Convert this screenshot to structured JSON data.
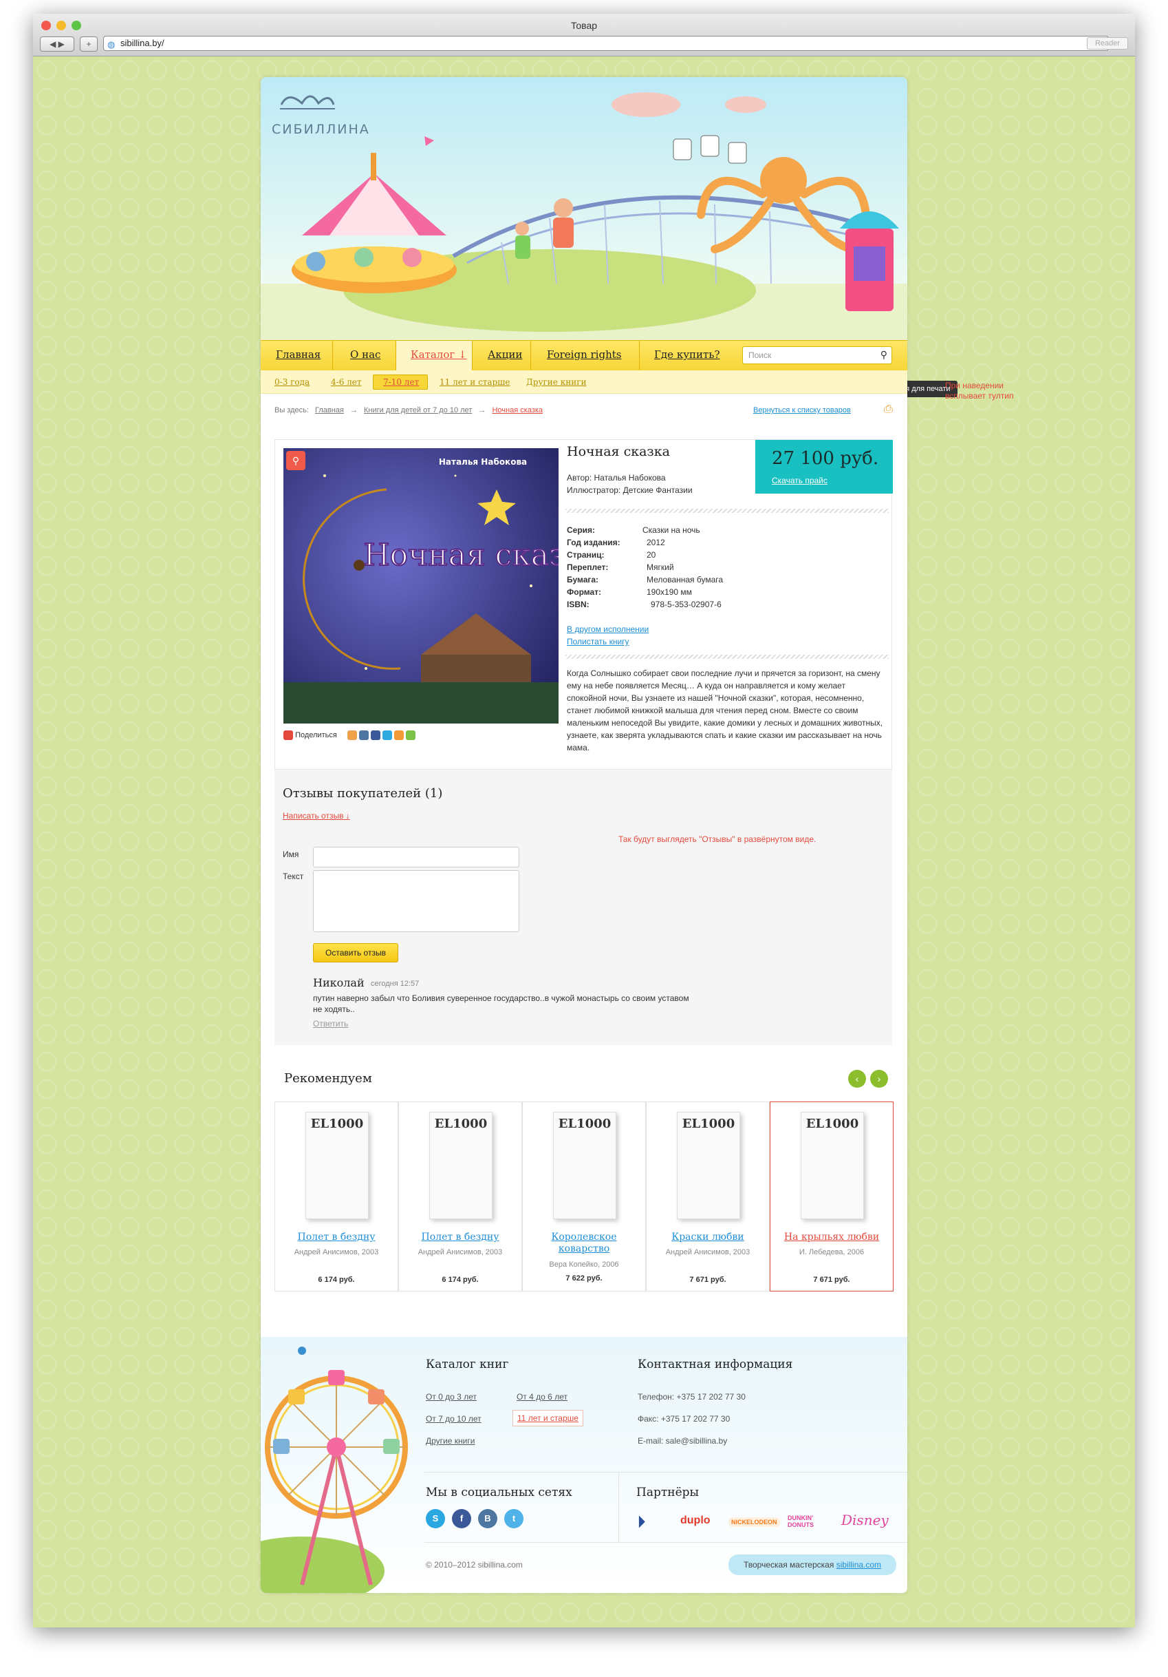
{
  "window": {
    "title": "Товар",
    "url": "sibillina.by/",
    "reader": "Reader"
  },
  "header": {
    "logo": "СИБИЛЛИНА"
  },
  "nav": {
    "items": [
      "Главная",
      "О нас",
      "Каталог ↓",
      "Акции",
      "Foreign rights",
      "Где купить?"
    ],
    "search_placeholder": "Поиск"
  },
  "subnav": [
    "0-3 года",
    "4-6 лет",
    "7-10 лет",
    "11 лет и старше",
    "Другие книги"
  ],
  "tooltip": {
    "text": "Версия для печати",
    "note": "При наведении всплывает тултип"
  },
  "breadcrumb": {
    "prefix": "Вы здесь:",
    "items": [
      "Главная",
      "Книги для детей от 7 до 10 лет",
      "Ночная сказка"
    ],
    "back": "Вернуться к списку товаров"
  },
  "product": {
    "title": "Ночная сказка",
    "author": "Автор: Наталья Набокова",
    "illustrator": "Иллюстратор: Детские Фантазии",
    "price": "27 100 руб.",
    "download": "Скачать прайс",
    "cover_author": "Наталья Набокова",
    "cover_title": "Ночная сказка",
    "specs": [
      {
        "k": "Серия:",
        "v": "Сказки на ночь"
      },
      {
        "k": "Год издания:",
        "v": "2012"
      },
      {
        "k": "Страниц:",
        "v": "20"
      },
      {
        "k": "Переплет:",
        "v": "Мягкий"
      },
      {
        "k": "Бумага:",
        "v": "Мелованная бумага"
      },
      {
        "k": "Формат:",
        "v": "190х190 мм"
      },
      {
        "k": "ISBN:",
        "v": "978-5-353-02907-6"
      }
    ],
    "link1": "В другом исполнении",
    "link2": "Полистать книгу",
    "description": "Когда Солнышко собирает свои последние лучи и прячется за горизонт, на смену ему на небе появляется Месяц… А куда он направляется и кому желает спокойной ночи, Вы узнаете из нашей \"Ночной сказки\", которая, несомненно, станет любимой книжкой малыша для чтения перед сном. Вместе со своим маленьким непоседой Вы увидите, какие домики у лесных и домашних животных, узнаете, как зверята укладываются спать и какие сказки им рассказывает на ночь мама.",
    "share": "Поделиться"
  },
  "reviews": {
    "title": "Отзывы покупателей (1)",
    "write": "Написать отзыв ↓",
    "note": "Так будут выглядеть \"Отзывы\" в развёрнутом виде.",
    "name_label": "Имя",
    "text_label": "Текст",
    "submit": "Оставить отзыв",
    "review": {
      "author": "Николай",
      "time": "сегодня 12:57",
      "text": "путин наверно забыл что Боливия суверенное государство..в чужой монастырь со своим уставом не ходять..",
      "reply": "Ответить"
    }
  },
  "recommend": {
    "title": "Рекомендуем",
    "cover_brand": "EL1000",
    "items": [
      {
        "title": "Полет в бездну",
        "meta": "Андрей Анисимов, 2003",
        "price": "6 174 руб."
      },
      {
        "title": "Полет в бездну",
        "meta": "Андрей Анисимов, 2003",
        "price": "6 174 руб."
      },
      {
        "title": "Королевское коварство",
        "meta": "Вера Копейко, 2006",
        "price": "7 622 руб."
      },
      {
        "title": "Краски любви",
        "meta": "Андрей Анисимов, 2003",
        "price": "7 671 руб."
      },
      {
        "title": "На крыльях любви",
        "meta": "И. Лебедева, 2006",
        "price": "7 671 руб."
      }
    ]
  },
  "footer": {
    "catalog_title": "Каталог книг",
    "catalog": [
      "От 0 до 3 лет",
      "От 4 до 6 лет",
      "От 7 до 10 лет",
      "11 лет и старше",
      "Другие книги"
    ],
    "contact_title": "Контактная информация",
    "phone": "Телефон: +375 17 202 77 30",
    "fax": "Факс: +375 17 202 77 30",
    "email": "E-mail: sale@sibillina.by",
    "social_title": "Мы в социальных сетях",
    "partners_title": "Партнёры",
    "partners": [
      "duplo",
      "NICKELODEON",
      "DUNKIN' DONUTS",
      "Disney"
    ],
    "copyright": "© 2010–2012 sibillina.com",
    "studio": "Творческая мастерская",
    "studio_link": "sibillina.com"
  },
  "colors": {
    "accent": "#e44a3c",
    "teal": "#19c0c2",
    "link": "#1e8ed7",
    "nav": "#ffe667"
  }
}
